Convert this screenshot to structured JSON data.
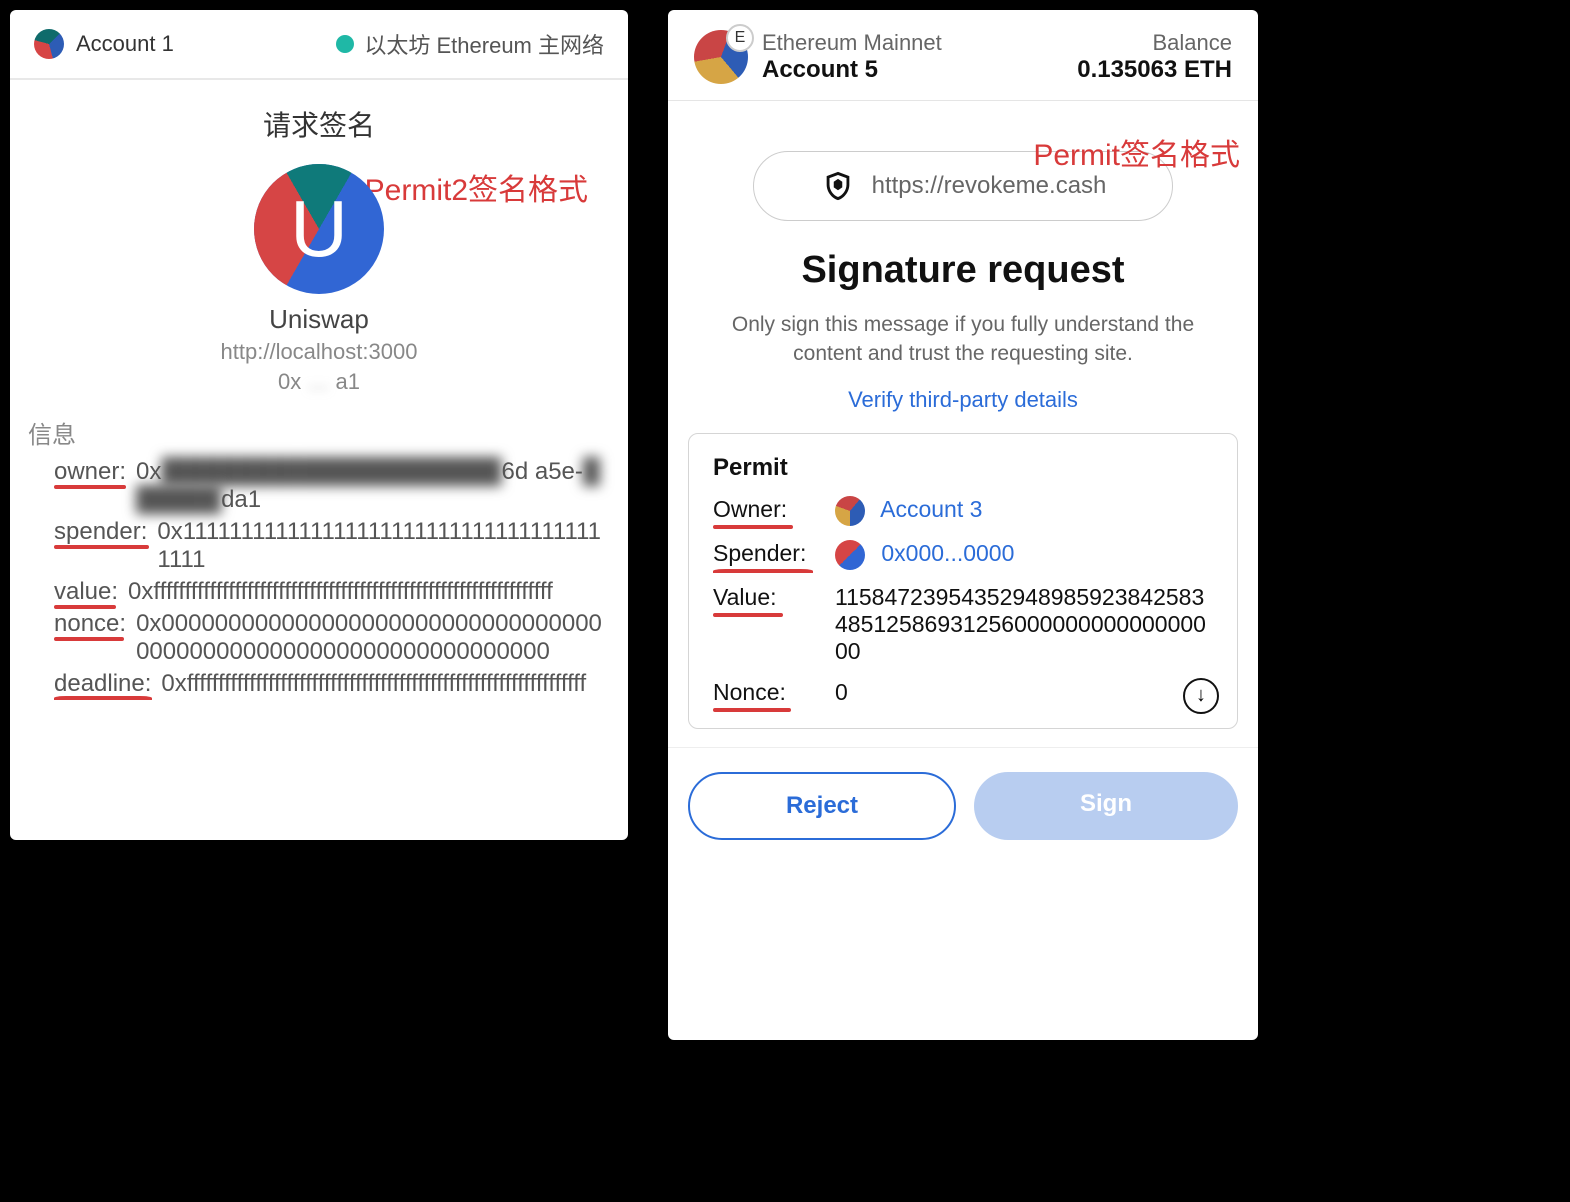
{
  "annotations": {
    "left": "Permit2签名格式",
    "right": "Permit签名格式"
  },
  "left": {
    "account": "Account 1",
    "network": "以太坊 Ethereum 主网络",
    "title": "请求签名",
    "app_name": "Uniswap",
    "app_url": "http://localhost:3000",
    "contract_prefix": "0x",
    "contract_blur": "   …   ",
    "contract_suffix": "a1",
    "info_label": "信息",
    "fields": {
      "owner": {
        "key": "owner:",
        "prefix": "0x",
        "blur": "████████████████████",
        "suffix": "6d a5e-",
        "blur2": "██████",
        "suffix2": "da1"
      },
      "spender": {
        "key": "spender:",
        "value": "0x1111111111111111111111111111111111111111"
      },
      "value": {
        "key": "value:",
        "value": "0xffffffffffffffffffffffffffffffffffffffffffffffffffffffffffffffff"
      },
      "nonce": {
        "key": "nonce:",
        "value": "0x0000000000000000000000000000000000000000000000000000000000000000"
      },
      "deadline": {
        "key": "deadline:",
        "value": "0xffffffffffffffffffffffffffffffffffffffffffffffffffffffffffffffff"
      }
    }
  },
  "right": {
    "avatar_badge": "E",
    "network": "Ethereum Mainnet",
    "account": "Account 5",
    "balance_label": "Balance",
    "balance_value": "0.135063 ETH",
    "site_url": "https://revokeme.cash",
    "sig_title": "Signature request",
    "warning": "Only sign this message if you fully understand the content and trust the requesting site.",
    "verify_link": "Verify third-party details",
    "permit": {
      "title": "Permit",
      "owner_key": "Owner:",
      "owner_value": "Account 3",
      "spender_key": "Spender:",
      "spender_value": "0x000...0000",
      "value_key": "Value:",
      "value_value": "115847239543529489859238425834851258693125600000000000000000",
      "nonce_key": "Nonce:",
      "nonce_value": "0"
    },
    "buttons": {
      "reject": "Reject",
      "sign": "Sign"
    }
  }
}
